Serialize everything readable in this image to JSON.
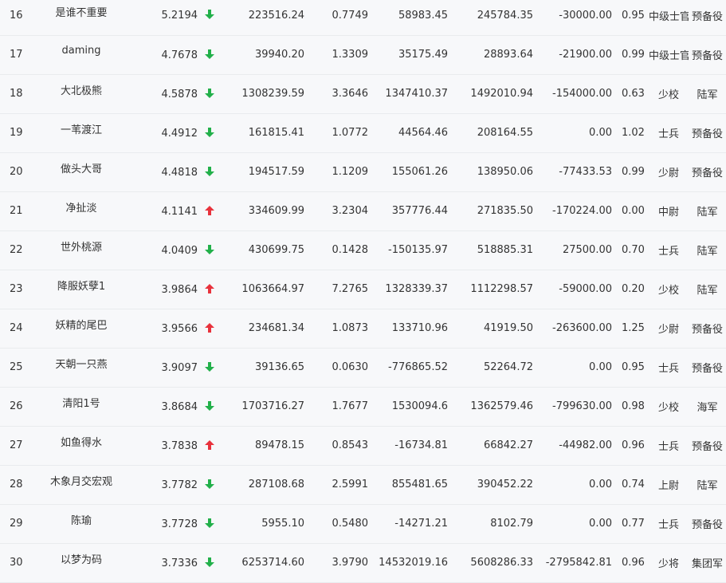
{
  "colors": {
    "down_arrow": "#22b04a",
    "up_arrow": "#e8323c",
    "background": "#f7f8fa",
    "row_border": "#e9ebee",
    "text": "#333333"
  },
  "rows": [
    {
      "rank": "16",
      "name": "是谁不重要",
      "score": "5.2194",
      "trend": "down",
      "total_assets": "223516.24",
      "ratio": "0.7749",
      "profit": "58983.45",
      "market_value": "245784.35",
      "net_flow": "-30000.00",
      "coefficient": "0.95",
      "military_rank": "中级士官",
      "branch": "预备役"
    },
    {
      "rank": "17",
      "name": "daming",
      "score": "4.7678",
      "trend": "down",
      "total_assets": "39940.20",
      "ratio": "1.3309",
      "profit": "35175.49",
      "market_value": "28893.64",
      "net_flow": "-21900.00",
      "coefficient": "0.99",
      "military_rank": "中级士官",
      "branch": "预备役"
    },
    {
      "rank": "18",
      "name": "大北极熊",
      "score": "4.5878",
      "trend": "down",
      "total_assets": "1308239.59",
      "ratio": "3.3646",
      "profit": "1347410.37",
      "market_value": "1492010.94",
      "net_flow": "-154000.00",
      "coefficient": "0.63",
      "military_rank": "少校",
      "branch": "陆军"
    },
    {
      "rank": "19",
      "name": "一苇渡江",
      "score": "4.4912",
      "trend": "down",
      "total_assets": "161815.41",
      "ratio": "1.0772",
      "profit": "44564.46",
      "market_value": "208164.55",
      "net_flow": "0.00",
      "coefficient": "1.02",
      "military_rank": "士兵",
      "branch": "预备役"
    },
    {
      "rank": "20",
      "name": "做头大哥",
      "score": "4.4818",
      "trend": "down",
      "total_assets": "194517.59",
      "ratio": "1.1209",
      "profit": "155061.26",
      "market_value": "138950.06",
      "net_flow": "-77433.53",
      "coefficient": "0.99",
      "military_rank": "少尉",
      "branch": "预备役"
    },
    {
      "rank": "21",
      "name": "净扯淡",
      "score": "4.1141",
      "trend": "up",
      "total_assets": "334609.99",
      "ratio": "3.2304",
      "profit": "357776.44",
      "market_value": "271835.50",
      "net_flow": "-170224.00",
      "coefficient": "0.00",
      "military_rank": "中尉",
      "branch": "陆军"
    },
    {
      "rank": "22",
      "name": "世外桃源",
      "score": "4.0409",
      "trend": "down",
      "total_assets": "430699.75",
      "ratio": "0.1428",
      "profit": "-150135.97",
      "market_value": "518885.31",
      "net_flow": "27500.00",
      "coefficient": "0.70",
      "military_rank": "士兵",
      "branch": "陆军"
    },
    {
      "rank": "23",
      "name": "降服妖孽1",
      "score": "3.9864",
      "trend": "up",
      "total_assets": "1063664.97",
      "ratio": "7.2765",
      "profit": "1328339.37",
      "market_value": "1112298.57",
      "net_flow": "-59000.00",
      "coefficient": "0.20",
      "military_rank": "少校",
      "branch": "陆军"
    },
    {
      "rank": "24",
      "name": "妖精的尾巴",
      "score": "3.9566",
      "trend": "up",
      "total_assets": "234681.34",
      "ratio": "1.0873",
      "profit": "133710.96",
      "market_value": "41919.50",
      "net_flow": "-263600.00",
      "coefficient": "1.25",
      "military_rank": "少尉",
      "branch": "预备役"
    },
    {
      "rank": "25",
      "name": "天朝一只燕",
      "score": "3.9097",
      "trend": "down",
      "total_assets": "39136.65",
      "ratio": "0.0630",
      "profit": "-776865.52",
      "market_value": "52264.72",
      "net_flow": "0.00",
      "coefficient": "0.95",
      "military_rank": "士兵",
      "branch": "预备役"
    },
    {
      "rank": "26",
      "name": "清阳1号",
      "score": "3.8684",
      "trend": "down",
      "total_assets": "1703716.27",
      "ratio": "1.7677",
      "profit": "1530094.6",
      "market_value": "1362579.46",
      "net_flow": "-799630.00",
      "coefficient": "0.98",
      "military_rank": "少校",
      "branch": "海军"
    },
    {
      "rank": "27",
      "name": "如鱼得水",
      "score": "3.7838",
      "trend": "up",
      "total_assets": "89478.15",
      "ratio": "0.8543",
      "profit": "-16734.81",
      "market_value": "66842.27",
      "net_flow": "-44982.00",
      "coefficient": "0.96",
      "military_rank": "士兵",
      "branch": "预备役"
    },
    {
      "rank": "28",
      "name": "木象月交宏观",
      "score": "3.7782",
      "trend": "down",
      "total_assets": "287108.68",
      "ratio": "2.5991",
      "profit": "855481.65",
      "market_value": "390452.22",
      "net_flow": "0.00",
      "coefficient": "0.74",
      "military_rank": "上尉",
      "branch": "陆军"
    },
    {
      "rank": "29",
      "name": "陈瑜",
      "score": "3.7728",
      "trend": "down",
      "total_assets": "5955.10",
      "ratio": "0.5480",
      "profit": "-14271.21",
      "market_value": "8102.79",
      "net_flow": "0.00",
      "coefficient": "0.77",
      "military_rank": "士兵",
      "branch": "预备役"
    },
    {
      "rank": "30",
      "name": "以梦为码",
      "score": "3.7336",
      "trend": "down",
      "total_assets": "6253714.60",
      "ratio": "3.9790",
      "profit": "14532019.16",
      "market_value": "5608286.33",
      "net_flow": "-2795842.81",
      "coefficient": "0.96",
      "military_rank": "少将",
      "branch": "集团军"
    }
  ]
}
